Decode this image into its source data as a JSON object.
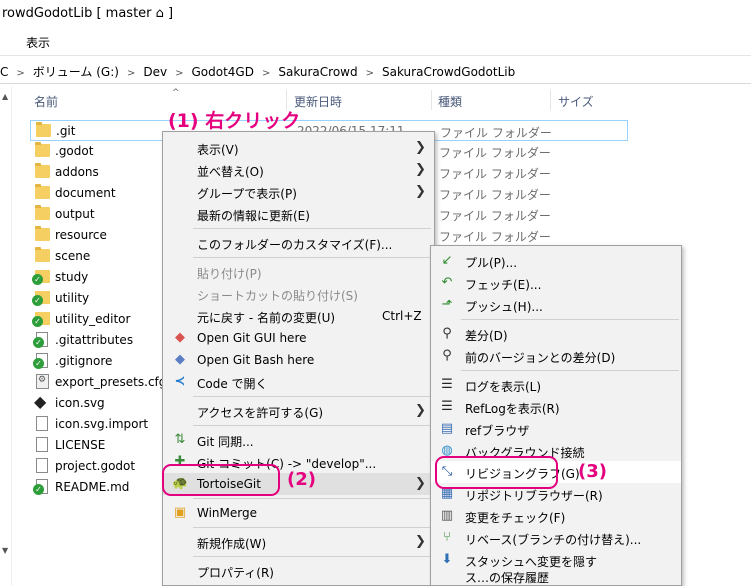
{
  "window": {
    "title": "rowdGodotLib [ master ⌂ ]"
  },
  "ribbon": {
    "view_tab": "表示"
  },
  "address": {
    "segments": [
      "C",
      "ボリューム (G:)",
      "Dev",
      "Godot4GD",
      "SakuraCrowd",
      "SakuraCrowdGodotLib"
    ]
  },
  "columns": {
    "name": "名前",
    "date": "更新日時",
    "type": "種類",
    "size": "サイズ"
  },
  "files": [
    {
      "name": ".git",
      "date": "2022/06/15 17:11",
      "type": "ファイル フォルダー",
      "icon": "folder-icon"
    },
    {
      "name": ".godot",
      "date": "",
      "type": "ファイル フォルダー",
      "icon": "folder-icon"
    },
    {
      "name": "addons",
      "date": "",
      "type": "ファイル フォルダー",
      "icon": "folder-icon"
    },
    {
      "name": "document",
      "date": "",
      "type": "ファイル フォルダー",
      "icon": "folder-icon"
    },
    {
      "name": "output",
      "date": "",
      "type": "ファイル フォルダー",
      "icon": "folder-icon"
    },
    {
      "name": "resource",
      "date": "",
      "type": "ファイル フォルダー",
      "icon": "folder-icon"
    },
    {
      "name": "scene",
      "date": "",
      "type": "ファイル フォルダー",
      "icon": "folder-icon"
    },
    {
      "name": "study",
      "date": "",
      "type": "",
      "icon": "git-folder-icon"
    },
    {
      "name": "utility",
      "date": "",
      "type": "",
      "icon": "git-folder-icon"
    },
    {
      "name": "utility_editor",
      "date": "",
      "type": "",
      "icon": "git-folder-icon"
    },
    {
      "name": ".gitattributes",
      "date": "",
      "type": "",
      "icon": "git-file-icon"
    },
    {
      "name": ".gitignore",
      "date": "",
      "type": "",
      "icon": "git-file-icon"
    },
    {
      "name": "export_presets.cfg",
      "date": "",
      "type": "",
      "icon": "config-file-icon"
    },
    {
      "name": "icon.svg",
      "date": "",
      "type": "",
      "icon": "svg-file-icon"
    },
    {
      "name": "icon.svg.import",
      "date": "",
      "type": "",
      "icon": "file-icon"
    },
    {
      "name": "LICENSE",
      "date": "",
      "type": "",
      "icon": "file-icon"
    },
    {
      "name": "project.godot",
      "date": "",
      "type": "",
      "icon": "file-icon"
    },
    {
      "name": "README.md",
      "date": "",
      "type": "",
      "icon": "git-file-icon"
    }
  ],
  "annotations": {
    "step1": "(1) 右クリック",
    "step2": "(2)",
    "step3": "(3)"
  },
  "context_menu": {
    "view": "表示(V)",
    "sort": "並べ替え(O)",
    "group": "グループで表示(P)",
    "refresh": "最新の情報に更新(E)",
    "customize": "このフォルダーのカスタマイズ(F)...",
    "paste": "貼り付け(P)",
    "paste_shortcut": "ショートカットの貼り付け(S)",
    "undo": "元に戻す - 名前の変更(U)",
    "undo_shortcut": "Ctrl+Z",
    "git_gui": "Open Git GUI here",
    "git_bash": "Open Git Bash here",
    "vscode": "Code で開く",
    "access": "アクセスを許可する(G)",
    "git_sync": "Git 同期...",
    "git_commit": "Git コミット(C) -> \"develop\"...",
    "tortoisegit": "TortoiseGit",
    "winmerge": "WinMerge",
    "new": "新規作成(W)",
    "properties": "プロパティ(R)"
  },
  "submenu": {
    "pull": "プル(P)...",
    "fetch": "フェッチ(E)...",
    "push": "プッシュ(H)...",
    "diff": "差分(D)",
    "diff_prev": "前のバージョンとの差分(D)",
    "show_log": "ログを表示(L)",
    "reflog": "RefLogを表示(R)",
    "refbrowser": "refブラウザ",
    "daemon": "バックグラウンド接続",
    "revgraph": "リビジョングラフ(G)",
    "repobrowser": "リポジトリブラウザー(R)",
    "check_mod": "変更をチェック(F)",
    "rebase": "リベース(ブランチの付け替え)...",
    "stash": "スタッシュへ変更を隠す",
    "cut_off": "ス…の保存履歴"
  },
  "colors": {
    "annotation": "#e4007f",
    "menu_bg": "#f2f2f2",
    "selection_border": "#99d1ff",
    "folder": "#f5cf61",
    "git_ok": "#2e9e3a"
  }
}
